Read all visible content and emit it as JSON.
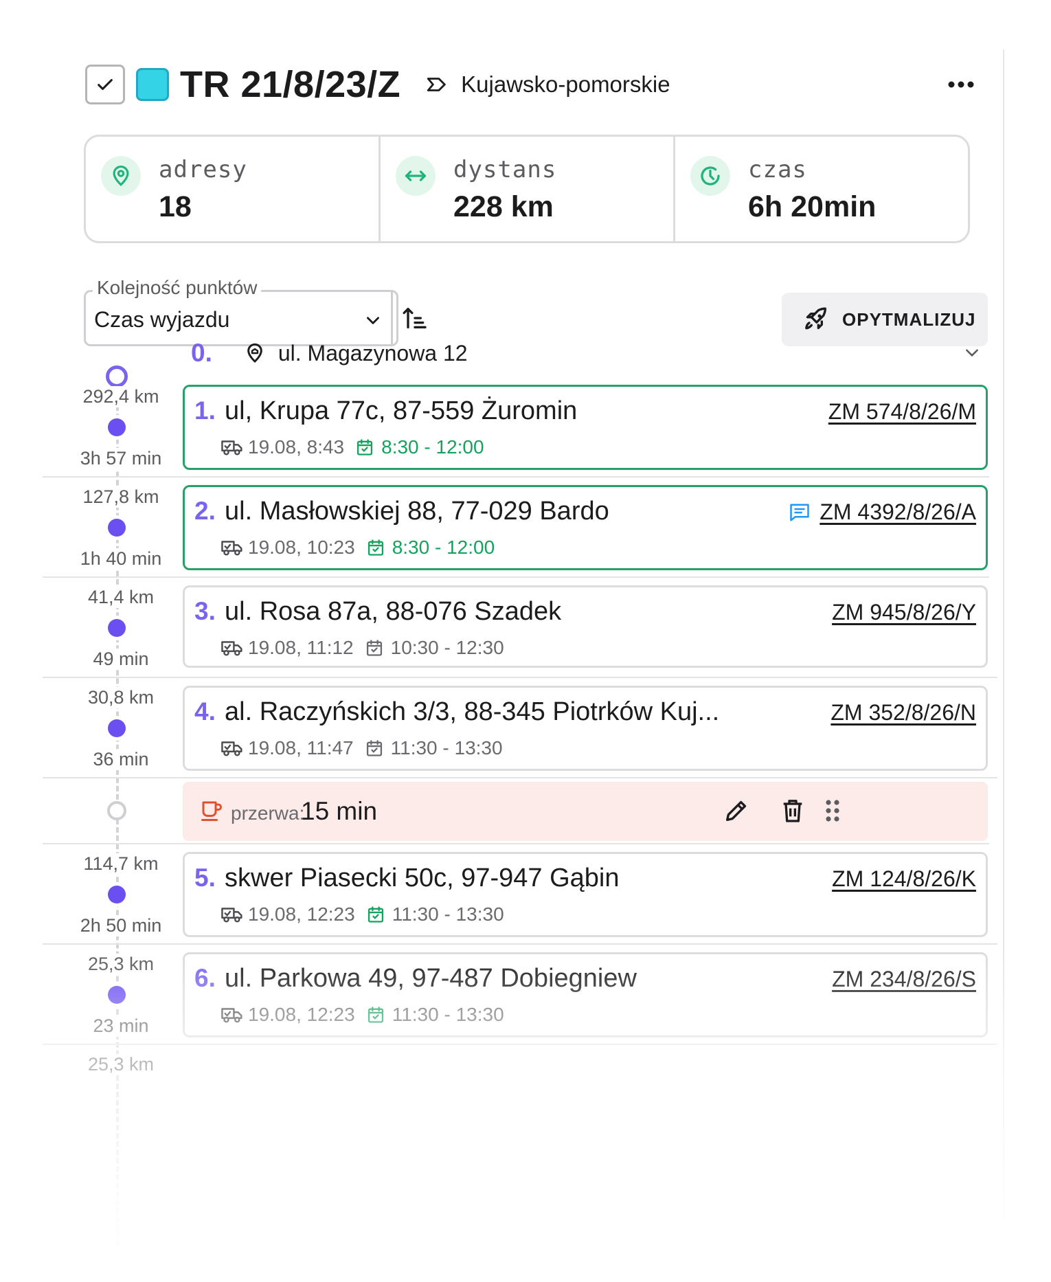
{
  "route": {
    "title": "TR 21/8/23/Z",
    "region": "Kujawsko-pomorskie",
    "swatch_color": "#34d3e6",
    "checked": true
  },
  "stats": [
    {
      "label": "adresy",
      "value": "18",
      "icon": "location-pin-icon"
    },
    {
      "label": "dystans",
      "value": "228 km",
      "icon": "distance-arrows-icon"
    },
    {
      "label": "czas",
      "value": "6h 20min",
      "icon": "clock-icon"
    }
  ],
  "sort": {
    "legend": "Kolejność punktów",
    "value": "Czas wyjazdu"
  },
  "optimize": {
    "label": "OPYTMALIZUJ"
  },
  "origin": {
    "number": "0.",
    "address": "ul. Magazynowa 12"
  },
  "stops": [
    {
      "number": "1.",
      "address": "ul, Krupa 77c, 87-559 Żuromin",
      "order": "ZM 574/8/26/M",
      "eta": "19.08, 8:43",
      "window": "8:30 - 12:00",
      "distance": "292,4 km",
      "duration": "3h 57 min",
      "has_note": false,
      "status": "confirmed"
    },
    {
      "number": "2.",
      "address": "ul. Masłowskiej 88, 77-029 Bardo",
      "order": "ZM 4392/8/26/A",
      "eta": "19.08, 10:23",
      "window": "8:30 - 12:00",
      "distance": "127,8 km",
      "duration": "1h 40 min",
      "has_note": true,
      "status": "confirmed"
    },
    {
      "number": "3.",
      "address": "ul. Rosa 87a, 88-076 Szadek",
      "order": "ZM 945/8/26/Y",
      "eta": "19.08, 11:12",
      "window": "10:30 - 12:30",
      "distance": "41,4 km",
      "duration": "49 min",
      "has_note": false,
      "status": "pending"
    },
    {
      "number": "4.",
      "address": "al. Raczyńskich 3/3, 88-345 Piotrków Kuj...",
      "order": "ZM 352/8/26/N",
      "eta": "19.08, 11:47",
      "window": "11:30 - 13:30",
      "distance": "30,8 km",
      "duration": "36 min",
      "has_note": false,
      "status": "pending"
    },
    {
      "number": "5.",
      "address": "skwer Piasecki 50c, 97-947 Gąbin",
      "order": "ZM 124/8/26/K",
      "eta": "19.08, 12:23",
      "window": "11:30 - 13:30",
      "distance": "114,7 km",
      "duration": "2h 50 min",
      "has_note": false,
      "status": "confirmed"
    },
    {
      "number": "6.",
      "address": "ul. Parkowa 49, 97-487 Dobiegniew",
      "order": "ZM 234/8/26/S",
      "eta": "19.08, 12:23",
      "window": "11:30 - 13:30",
      "distance": "25,3 km",
      "duration": "23 min",
      "has_note": false,
      "status": "confirmed"
    }
  ],
  "next_segment": {
    "distance": "25,3 km"
  },
  "break": {
    "label": "przerwa:",
    "value": "15 min"
  },
  "colors": {
    "accent_purple": "#7b63f0",
    "timeline_dot": "#6b4ff0",
    "success_green": "#27a06a",
    "break_bg": "#fcebe9",
    "break_icon": "#e0522f",
    "note_blue": "#2196f3"
  }
}
